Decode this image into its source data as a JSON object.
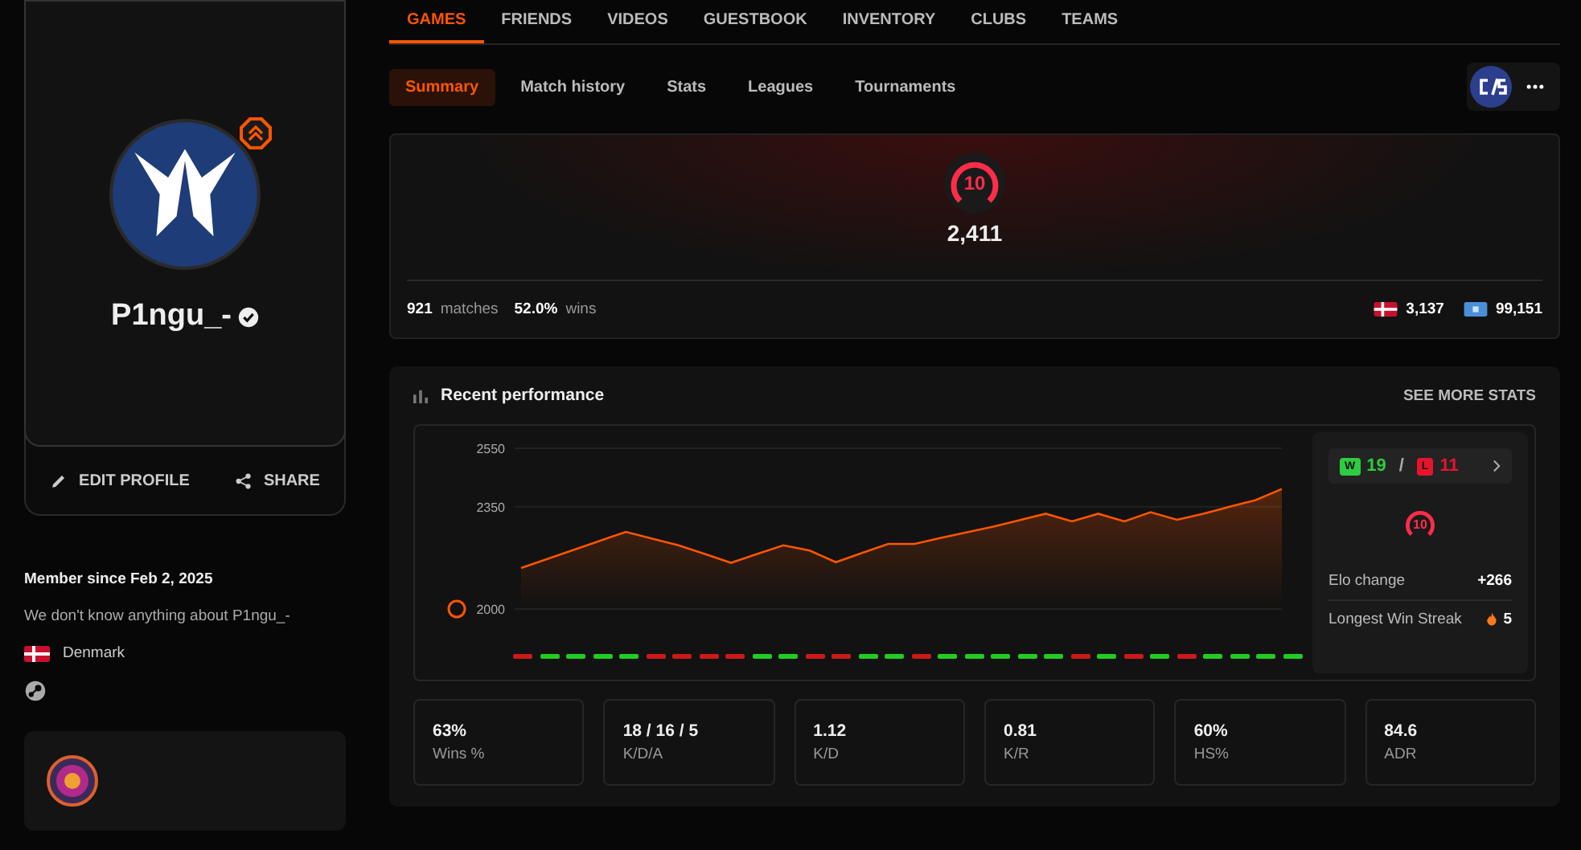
{
  "profile": {
    "name": "P1ngu_-",
    "verified": true,
    "actions": [
      {
        "kind": "edit",
        "label": "EDIT PROFILE"
      },
      {
        "kind": "share",
        "label": "SHARE"
      }
    ]
  },
  "about": {
    "member_since": "Member since Feb 2, 2025",
    "bio": "We don't know anything about P1ngu_-",
    "country": "Denmark"
  },
  "nav_tabs": [
    {
      "label": "GAMES",
      "selected": true
    },
    {
      "label": "FRIENDS",
      "selected": false
    },
    {
      "label": "VIDEOS",
      "selected": false
    },
    {
      "label": "GUESTBOOK",
      "selected": false
    },
    {
      "label": "INVENTORY",
      "selected": false
    },
    {
      "label": "CLUBS",
      "selected": false
    },
    {
      "label": "TEAMS",
      "selected": false
    }
  ],
  "sub_tabs": [
    {
      "label": "Summary",
      "selected": true
    },
    {
      "label": "Match history",
      "selected": false
    },
    {
      "label": "Stats",
      "selected": false
    },
    {
      "label": "Leagues",
      "selected": false
    },
    {
      "label": "Tournaments",
      "selected": false
    }
  ],
  "rating": {
    "level": "10",
    "elo": "2,411",
    "matches": "921",
    "matches_label": "matches",
    "winrate": "52.0%",
    "wins_label": "wins",
    "country_rank": "3,137",
    "region_rank": "99,151"
  },
  "performance": {
    "title": "Recent performance",
    "link": "SEE MORE STATS",
    "chart_data": {
      "type": "area",
      "ylim": [
        2000,
        2550
      ],
      "yticks": [
        2000,
        2350,
        2550
      ],
      "series": [
        {
          "color": "#ff5500",
          "values": [
            2140,
            2171,
            2202,
            2233,
            2264,
            2241,
            2218,
            2188,
            2158,
            2188,
            2218,
            2200,
            2160,
            2192,
            2223,
            2223,
            2243,
            2263,
            2282,
            2304,
            2326,
            2300,
            2326,
            2300,
            2331,
            2305,
            2326,
            2350,
            2373,
            2411
          ]
        }
      ]
    },
    "results": [
      {
        "win": false
      },
      {
        "win": true
      },
      {
        "win": true
      },
      {
        "win": true
      },
      {
        "win": true
      },
      {
        "win": false
      },
      {
        "win": false
      },
      {
        "win": false
      },
      {
        "win": false
      },
      {
        "win": true
      },
      {
        "win": true
      },
      {
        "win": false
      },
      {
        "win": false
      },
      {
        "win": true
      },
      {
        "win": true
      },
      {
        "win": false
      },
      {
        "win": true
      },
      {
        "win": true
      },
      {
        "win": true
      },
      {
        "win": true
      },
      {
        "win": true
      },
      {
        "win": false
      },
      {
        "win": true
      },
      {
        "win": false
      },
      {
        "win": true
      },
      {
        "win": false
      },
      {
        "win": true
      },
      {
        "win": true
      },
      {
        "win": true
      },
      {
        "win": true
      }
    ],
    "summary": {
      "win_badge": "W",
      "wins": "19",
      "separator": "/",
      "loss_badge": "L",
      "losses": "11",
      "level": "10",
      "rows": [
        {
          "kind": "plain",
          "label": "Elo change",
          "value": "+266"
        },
        {
          "kind": "streak",
          "label": "Longest Win Streak",
          "value": "5"
        }
      ]
    },
    "stats": [
      {
        "value": "63%",
        "label": "Wins %"
      },
      {
        "value": "18 / 16 / 5",
        "label": "K/D/A"
      },
      {
        "value": "1.12",
        "label": "K/D"
      },
      {
        "value": "0.81",
        "label": "K/R"
      },
      {
        "value": "60%",
        "label": "HS%"
      },
      {
        "value": "84.6",
        "label": "ADR"
      }
    ]
  }
}
